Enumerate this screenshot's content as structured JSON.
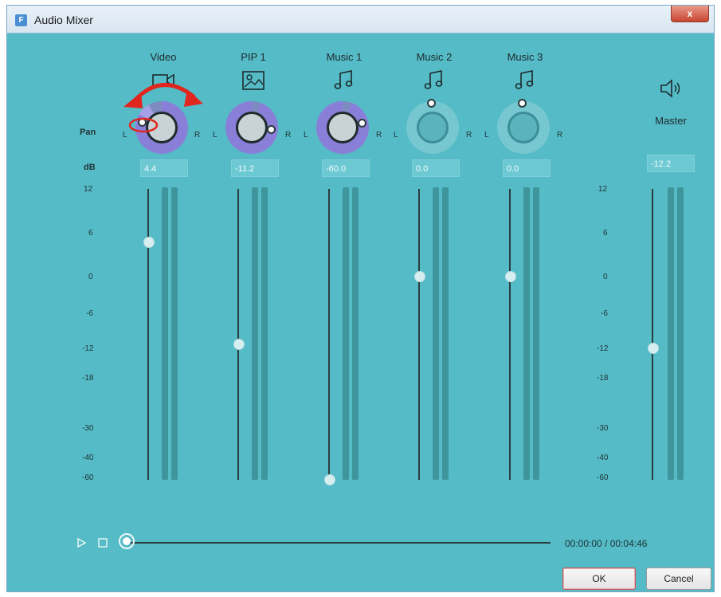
{
  "window": {
    "title": "Audio Mixer",
    "close_label": "x",
    "app_icon_letter": "F"
  },
  "labels": {
    "pan": "Pan",
    "db": "dB",
    "left": "L",
    "right": "R"
  },
  "channels": [
    {
      "name": "Video",
      "icon": "video-camera-icon",
      "db": "4.4",
      "active": true,
      "fader_level": 4.4
    },
    {
      "name": "PIP 1",
      "icon": "image-icon",
      "db": "-11.2",
      "active": true,
      "fader_level": -11.2
    },
    {
      "name": "Music 1",
      "icon": "music-note-icon",
      "db": "-60.0",
      "active": true,
      "fader_level": -60
    },
    {
      "name": "Music 2",
      "icon": "music-note-icon",
      "db": "0.0",
      "active": false,
      "fader_level": 0
    },
    {
      "name": "Music 3",
      "icon": "music-note-icon",
      "db": "0.0",
      "active": false,
      "fader_level": 0
    }
  ],
  "master": {
    "name": "Master",
    "icon": "speaker-icon",
    "db": "-12.2",
    "fader_level": -12.2
  },
  "scale_ticks": [
    "12",
    "6",
    "0",
    "-6",
    "-12",
    "-18",
    "-30",
    "-40",
    "-60"
  ],
  "playback": {
    "time": "00:00:00 / 00:04:46",
    "play_icon": "play-icon",
    "stop_icon": "stop-icon"
  },
  "buttons": {
    "ok": "OK",
    "cancel": "Cancel"
  },
  "colors": {
    "background": "#55bbc6",
    "knob_active": "#8a7fd8",
    "annotation": "#e0261e"
  }
}
